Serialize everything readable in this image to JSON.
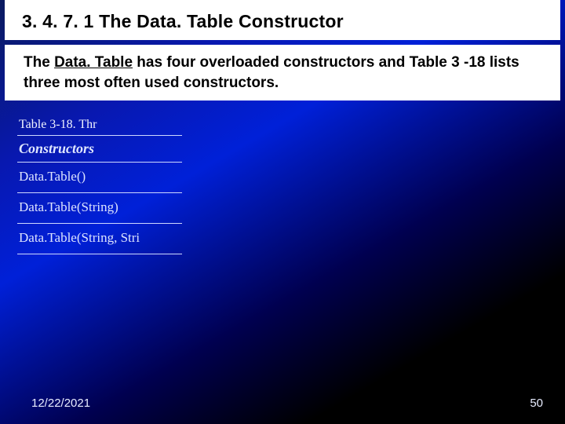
{
  "title": "3. 4. 7. 1   The Data. Table Constructor",
  "body": {
    "lead_text": "The ",
    "underlined": "Data. Table",
    "rest": " has four overloaded constructors and Table 3 -18 lists three most often used constructors."
  },
  "table": {
    "caption": "Table 3-18. Thr",
    "header": "Constructors",
    "rows": [
      "Data.Table()",
      "Data.Table(String)",
      "Data.Table(String, Stri"
    ]
  },
  "footer": {
    "date": "12/22/2021",
    "page": "50"
  }
}
